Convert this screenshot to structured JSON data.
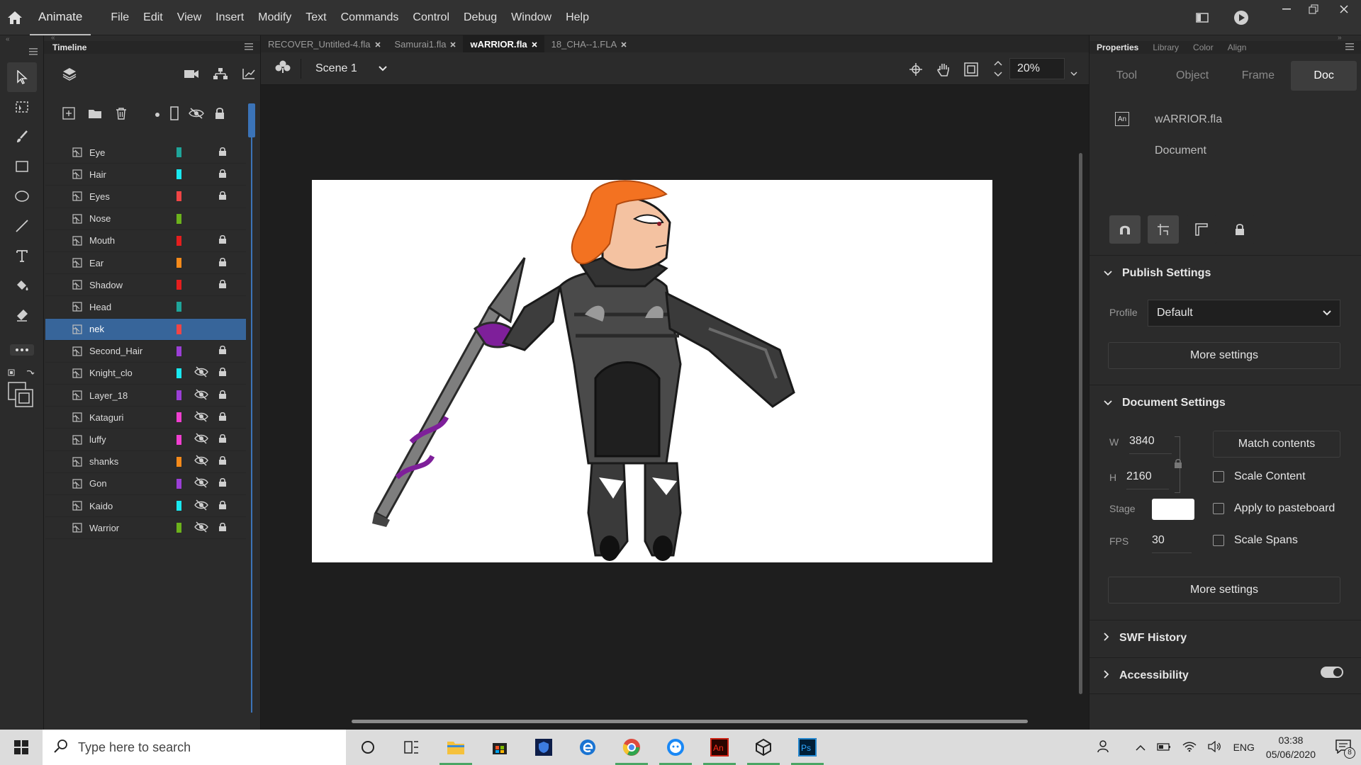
{
  "app": {
    "name": "Animate",
    "menus": [
      "File",
      "Edit",
      "View",
      "Insert",
      "Modify",
      "Text",
      "Commands",
      "Control",
      "Debug",
      "Window",
      "Help"
    ]
  },
  "timeline": {
    "title": "Timeline",
    "layers": [
      {
        "name": "Eye",
        "color": "#1fa59a",
        "hidden": false,
        "locked": true
      },
      {
        "name": "Hair",
        "color": "#19e8f0",
        "hidden": false,
        "locked": true
      },
      {
        "name": "Eyes",
        "color": "#f04545",
        "hidden": false,
        "locked": true
      },
      {
        "name": "Nose",
        "color": "#6cb21c",
        "hidden": false,
        "locked": false
      },
      {
        "name": "Mouth",
        "color": "#e41e1e",
        "hidden": false,
        "locked": true
      },
      {
        "name": "Ear",
        "color": "#f58a1a",
        "hidden": false,
        "locked": true
      },
      {
        "name": "Shadow",
        "color": "#e41e1e",
        "hidden": false,
        "locked": true
      },
      {
        "name": "Head",
        "color": "#1fa59a",
        "hidden": false,
        "locked": false
      },
      {
        "name": "nek",
        "color": "#f04545",
        "hidden": false,
        "locked": false,
        "selected": true
      },
      {
        "name": "Second_Hair",
        "color": "#9b3fd6",
        "hidden": false,
        "locked": true
      },
      {
        "name": "Knight_clo",
        "color": "#19e8f0",
        "hidden": true,
        "locked": true
      },
      {
        "name": "Layer_18",
        "color": "#9b3fd6",
        "hidden": true,
        "locked": true
      },
      {
        "name": "Kataguri",
        "color": "#f03fd0",
        "hidden": true,
        "locked": true
      },
      {
        "name": "luffy",
        "color": "#f03fd0",
        "hidden": true,
        "locked": true
      },
      {
        "name": "shanks",
        "color": "#f58a1a",
        "hidden": true,
        "locked": true
      },
      {
        "name": "Gon",
        "color": "#9b3fd6",
        "hidden": true,
        "locked": true
      },
      {
        "name": "Kaido",
        "color": "#19e8f0",
        "hidden": true,
        "locked": true
      },
      {
        "name": "Warrior",
        "color": "#6cb21c",
        "hidden": true,
        "locked": true
      }
    ]
  },
  "tabs": [
    {
      "label": "RECOVER_Untitled-4.fla",
      "active": false
    },
    {
      "label": "Samurai1.fla",
      "active": false
    },
    {
      "label": "wARRIOR.fla",
      "active": true
    },
    {
      "label": "18_CHA--1.FLA",
      "active": false
    }
  ],
  "scene": {
    "label": "Scene 1",
    "zoom": "20%"
  },
  "properties": {
    "panel_tabs": [
      "Properties",
      "Library",
      "Color",
      "Align"
    ],
    "sub_tabs": [
      "Tool",
      "Object",
      "Frame",
      "Doc"
    ],
    "doc_name": "wARRIOR.fla",
    "doc_type": "Document",
    "publish": {
      "title": "Publish Settings",
      "profile_label": "Profile",
      "profile_value": "Default",
      "more": "More settings"
    },
    "document": {
      "title": "Document Settings",
      "w_label": "W",
      "w_value": "3840",
      "h_label": "H",
      "h_value": "2160",
      "match": "Match contents",
      "stage_label": "Stage",
      "stage_color": "#ffffff",
      "fps_label": "FPS",
      "fps_value": "30",
      "scale_content": "Scale Content",
      "apply_pasteboard": "Apply to pasteboard",
      "scale_spans": "Scale Spans",
      "more": "More settings"
    },
    "swf_history": "SWF History",
    "accessibility": "Accessibility",
    "accessibility_on": true
  },
  "taskbar": {
    "search_placeholder": "Type here to search",
    "lang": "ENG",
    "time": "03:38",
    "date": "05/06/2020",
    "notifications": "8"
  }
}
